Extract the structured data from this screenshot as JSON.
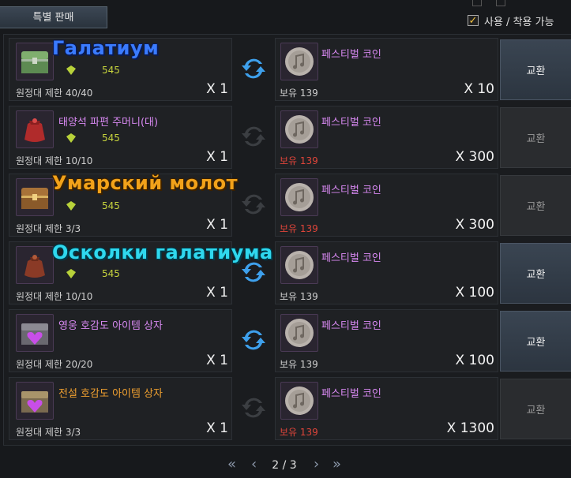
{
  "tab": {
    "label": "특별 판매"
  },
  "filter": {
    "label": "사용 / 착용 가능",
    "checked": true,
    "check_glyph": "✓"
  },
  "exchange_label": "교환",
  "rows": [
    {
      "item_name": "",
      "points": "545",
      "limit": "원정대 제한 40/40",
      "qty": "X 1",
      "coin_name": "페스티벌 코인",
      "owned": "보유 139",
      "owned_short": false,
      "cost": "X 10",
      "exchange_enabled": true,
      "icon": "chest-green-icon",
      "arrows_active": true
    },
    {
      "item_name": "태양석 파편 주머니(대)",
      "points": "545",
      "limit": "원정대 제한 10/10",
      "qty": "X 1",
      "coin_name": "페스티벌 코인",
      "owned": "보유 139",
      "owned_short": true,
      "cost": "X 300",
      "exchange_enabled": false,
      "icon": "pouch-red-icon",
      "arrows_active": false
    },
    {
      "item_name": "",
      "points": "545",
      "limit": "원정대 제한 3/3",
      "qty": "X 1",
      "coin_name": "페스티벌 코인",
      "owned": "보유 139",
      "owned_short": true,
      "cost": "X 300",
      "exchange_enabled": false,
      "icon": "chest-gold-icon",
      "arrows_active": false
    },
    {
      "item_name": "",
      "points": "545",
      "limit": "원정대 제한 10/10",
      "qty": "X 1",
      "coin_name": "페스티벌 코인",
      "owned": "보유 139",
      "owned_short": false,
      "cost": "X 100",
      "exchange_enabled": true,
      "icon": "pouch-brown-icon",
      "arrows_active": true
    },
    {
      "item_name": "영웅 호감도 아이템 상자",
      "points": "",
      "limit": "원정대 제한 20/20",
      "qty": "X 1",
      "coin_name": "페스티벌 코인",
      "owned": "보유 139",
      "owned_short": false,
      "cost": "X 100",
      "exchange_enabled": true,
      "icon": "heart-box-icon",
      "arrows_active": true
    },
    {
      "item_name": "전설 호감도 아이템 상자",
      "points": "",
      "limit": "원정대 제한 3/3",
      "qty": "X 1",
      "coin_name": "페스티벌 코인",
      "owned": "보유 139",
      "owned_short": true,
      "cost": "X 1300",
      "exchange_enabled": false,
      "icon": "heart-box-gold-icon",
      "arrows_active": false,
      "legendary": true
    }
  ],
  "overlays": [
    {
      "text": "Галатиум"
    },
    {
      "text": "Умарский молот"
    },
    {
      "text": "Осколки галатиума"
    }
  ],
  "pager": {
    "page": "2 / 3",
    "first": "«",
    "prev": "‹",
    "next": "›",
    "last": "»"
  }
}
